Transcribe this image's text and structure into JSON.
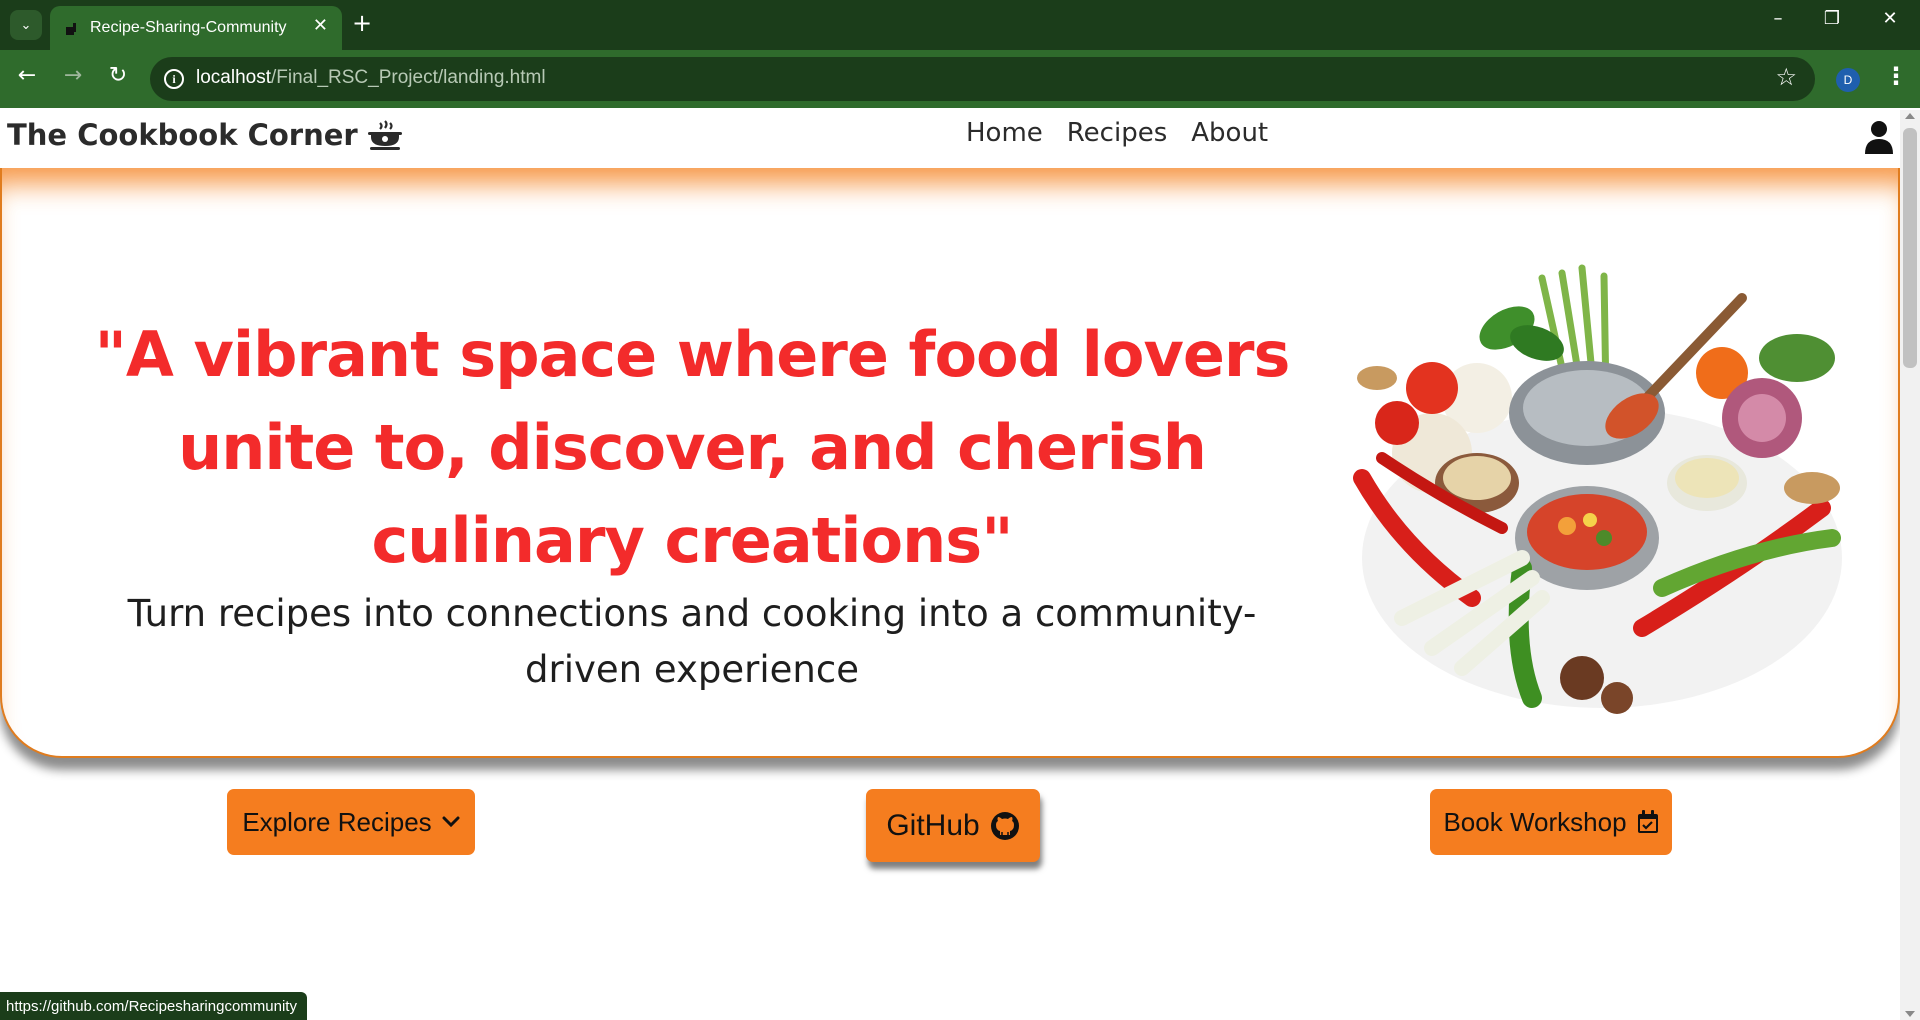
{
  "browser": {
    "tab_title": "Recipe-Sharing-Community",
    "url_host": "localhost",
    "url_path": "/Final_RSC_Project/landing.html",
    "profile_initial": "D",
    "status_url": "https://github.com/Recipesharingcommunity"
  },
  "navbar": {
    "brand": "The Cookbook Corner",
    "links": [
      "Home",
      "Recipes",
      "About"
    ]
  },
  "hero": {
    "quote_lines": [
      "\"A vibrant space where food lovers",
      "unite to, discover, and cherish",
      "culinary creations\""
    ],
    "tagline_lines": [
      "Turn recipes into connections and cooking into a community-",
      "driven experience"
    ]
  },
  "actions": {
    "explore": "Explore Recipes",
    "github": "GitHub",
    "workshop": "Book Workshop"
  },
  "colors": {
    "accent_orange": "#f57d1f",
    "quote_red": "#f32b2b",
    "browser_green": "#2f6b2c"
  },
  "icons": [
    "chevron-down-icon",
    "github-icon",
    "calendar-check-icon",
    "user-icon",
    "cooking-pot-icon"
  ]
}
